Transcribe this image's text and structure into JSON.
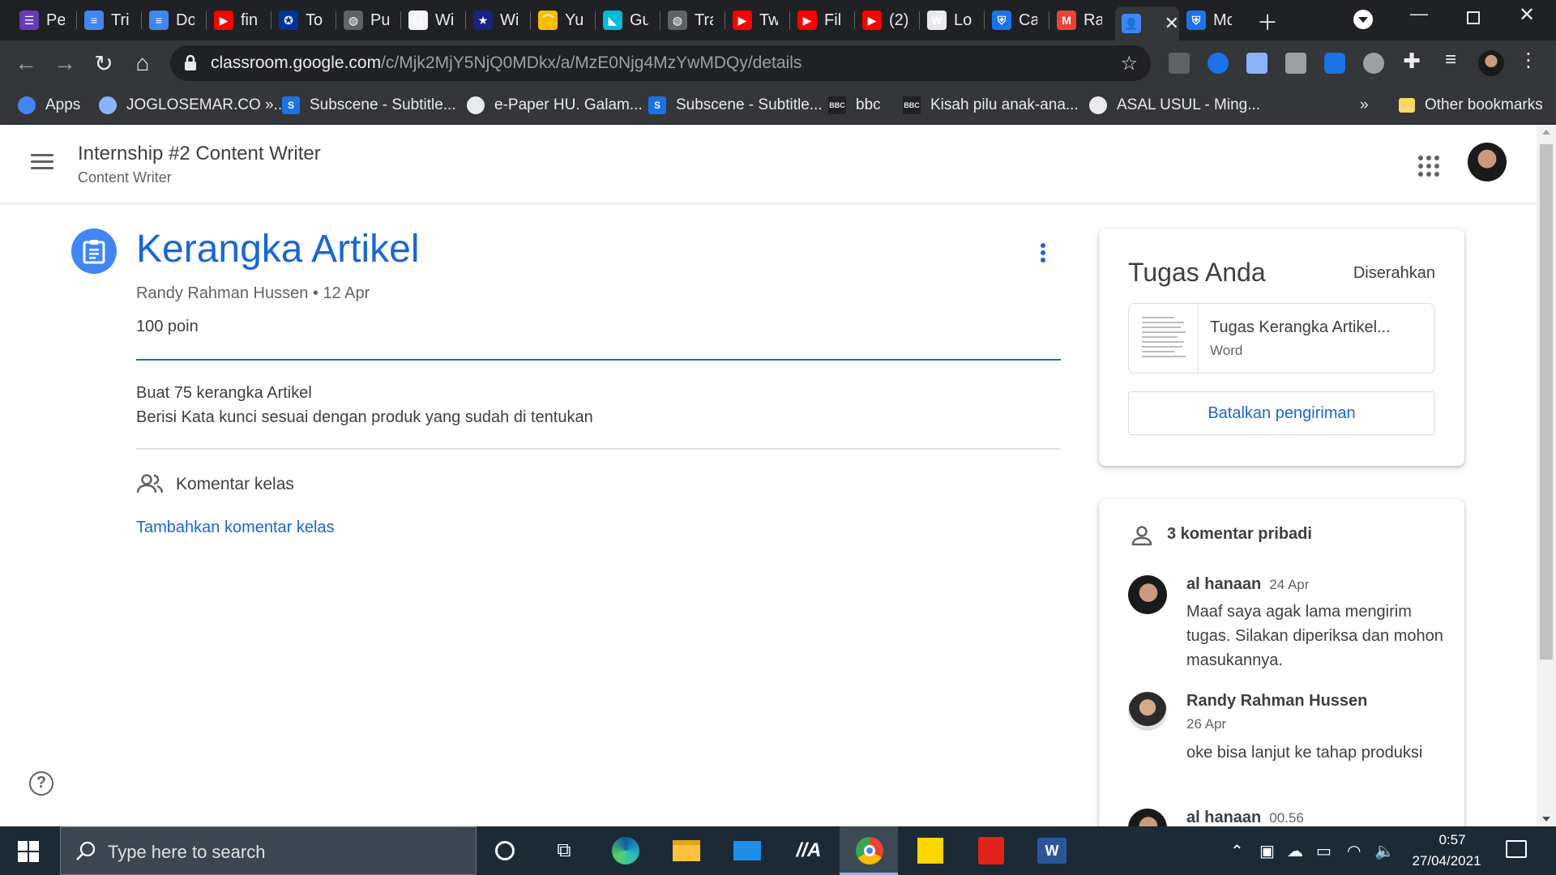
{
  "tabs": [
    {
      "title": "Pe",
      "color": "#673ab7",
      "glyph": "☰"
    },
    {
      "title": "Tri",
      "color": "#4285f4",
      "glyph": "≡"
    },
    {
      "title": "Do",
      "color": "#4285f4",
      "glyph": "≡"
    },
    {
      "title": "fin",
      "color": "#ff0000",
      "glyph": "▶"
    },
    {
      "title": "To",
      "color": "#003399",
      "glyph": "✪"
    },
    {
      "title": "Pu",
      "color": "#5f6368",
      "glyph": "◍"
    },
    {
      "title": "Wi",
      "color": "#f1f3f4",
      "glyph": "▤"
    },
    {
      "title": "Wi",
      "color": "#1a237e",
      "glyph": "★"
    },
    {
      "title": "Yu",
      "color": "#fbbc04",
      "glyph": "⌒"
    },
    {
      "title": "Gu",
      "color": "#00bcd4",
      "glyph": "◣"
    },
    {
      "title": "Tra",
      "color": "#5f6368",
      "glyph": "◍"
    },
    {
      "title": "Tw",
      "color": "#ff0000",
      "glyph": "▶"
    },
    {
      "title": "Fil",
      "color": "#ff0000",
      "glyph": "▶"
    },
    {
      "title": "(2)",
      "color": "#ff0000",
      "glyph": "▶"
    },
    {
      "title": "Lo",
      "color": "#e8eaed",
      "glyph": "W"
    },
    {
      "title": "Ca",
      "color": "#1a73e8",
      "glyph": "⛨"
    },
    {
      "title": "Ra",
      "color": "#ea4335",
      "glyph": "M"
    },
    {
      "title": "",
      "color": "#4285f4",
      "glyph": "👤"
    },
    {
      "title": "Mo",
      "color": "#1a73e8",
      "glyph": "⛨"
    }
  ],
  "url": {
    "host": "classroom.google.com",
    "path": "/c/Mjk2MjY5NjQ0MDkx/a/MzE0Njg4MzYwMDQy/details"
  },
  "bookmarks": [
    {
      "label": "Apps",
      "icon": "apps-grid-icon",
      "color": "#4285f4"
    },
    {
      "label": "JOGLOSEMAR.CO »...",
      "icon": "globe-icon",
      "color": "#8ab4f8"
    },
    {
      "label": "Subscene - Subtitle...",
      "icon": "subscene-icon",
      "color": "#1a73e8"
    },
    {
      "label": "e-Paper HU. Galam...",
      "icon": "globe-icon",
      "color": "#e8eaed"
    },
    {
      "label": "Subscene - Subtitle...",
      "icon": "subscene-icon",
      "color": "#1a73e8"
    },
    {
      "label": "bbc",
      "icon": "bbc-icon",
      "color": "#202124"
    },
    {
      "label": "Kisah pilu anak-ana...",
      "icon": "bbc-icon",
      "color": "#202124"
    },
    {
      "label": "ASAL USUL - Ming...",
      "icon": "globe-icon",
      "color": "#e8eaed"
    }
  ],
  "bookmarks_overflow": "»",
  "other_bookmarks": "Other bookmarks",
  "classroom": {
    "title": "Internship #2 Content Writer",
    "subtitle": "Content Writer"
  },
  "assignment": {
    "title": "Kerangka Artikel",
    "meta": "Randy Rahman Hussen • 12 Apr",
    "points": "100 poin",
    "description": [
      "Buat 75 kerangka Artikel",
      "Berisi Kata kunci sesuai dengan produk yang sudah di tentukan"
    ],
    "class_comments_label": "Komentar kelas",
    "add_class_comment": "Tambahkan komentar kelas"
  },
  "your_work": {
    "title": "Tugas Anda",
    "status": "Diserahkan",
    "attachment": {
      "name": "Tugas Kerangka Artikel...",
      "type": "Word"
    },
    "unsubmit_label": "Batalkan pengiriman"
  },
  "private_comments": {
    "header": "3 komentar pribadi",
    "items": [
      {
        "author": "al hanaan",
        "date": "24 Apr",
        "text": "Maaf saya agak lama mengirim tugas. Silakan diperiksa dan mohon masukannya."
      },
      {
        "author": "Randy Rahman Hussen",
        "date": "26 Apr",
        "text": "oke bisa lanjut ke tahap produksi"
      },
      {
        "author": "al hanaan",
        "date": "00.56",
        "text": ""
      }
    ]
  },
  "taskbar": {
    "search_placeholder": "Type here to search",
    "time": "0:57",
    "date": "27/04/2021"
  },
  "colors": {
    "accent": "#1967d2",
    "classroom_blue": "#4285f4"
  }
}
